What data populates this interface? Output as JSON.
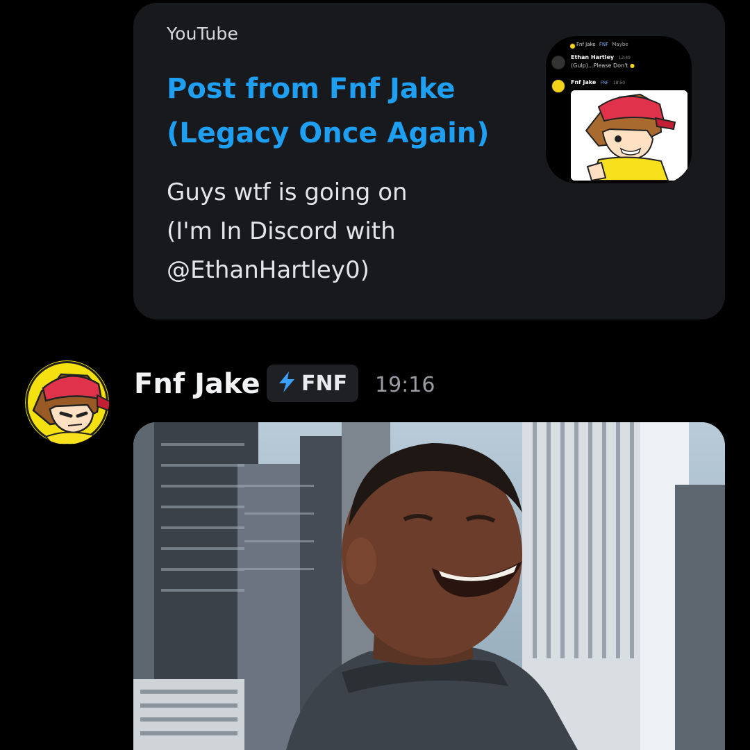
{
  "embed": {
    "provider": "YouTube",
    "title_line1": "Post from Fnf Jake",
    "title_line2": "(Legacy Once Again)",
    "description_line1": "Guys wtf is going on",
    "description_line2": "(I'm In Discord with",
    "description_line3": "@EthanHartley0)",
    "thumbnail": {
      "row1_name": "Fnf Jake",
      "row1_tag": "FNF",
      "row1_text": "Maybe",
      "row2_name": "Ethan Hartley",
      "row2_time": "12:49",
      "row2_text": "(Gulp)...Please Don't",
      "row3_name": "Fnf Jake",
      "row3_tag": "FNF",
      "row3_time": "18:50"
    }
  },
  "message": {
    "username": "Fnf Jake",
    "tag": "FNF",
    "timestamp": "19:16"
  },
  "colors": {
    "background": "#000000",
    "embed_bg": "#18191d",
    "link": "#1e9ff2",
    "tag_bolt": "#3aa0ff",
    "timestamp": "#9a9ca3"
  }
}
